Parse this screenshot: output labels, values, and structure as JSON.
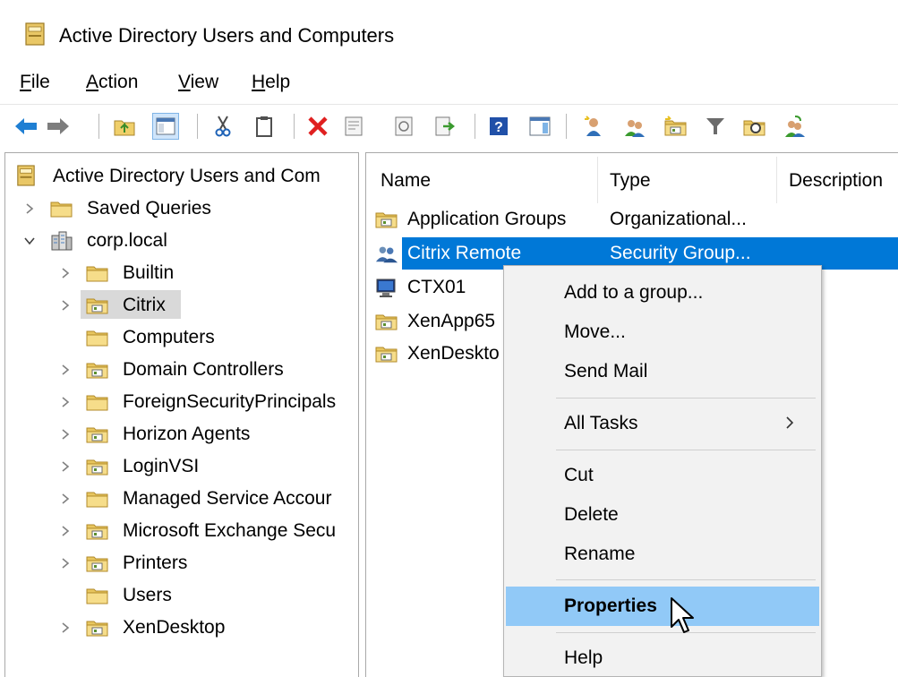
{
  "window": {
    "title": "Active Directory Users and Computers"
  },
  "menubar": [
    {
      "label": "File",
      "underline": "F",
      "rest": "ile"
    },
    {
      "label": "Action",
      "underline": "A",
      "rest": "ction"
    },
    {
      "label": "View",
      "underline": "V",
      "rest": "iew"
    },
    {
      "label": "Help",
      "underline": "H",
      "rest": "elp"
    }
  ],
  "toolbar": {
    "buttons": [
      "back-icon",
      "forward-icon",
      "up-folder-icon",
      "show-tree-icon",
      "cut-icon",
      "copy-icon",
      "delete-icon",
      "properties-icon",
      "refresh-icon",
      "export-list-icon",
      "help-icon",
      "mmc-icon",
      "new-user-icon",
      "new-group-icon",
      "new-ou-icon",
      "filter-icon",
      "find-icon",
      "add-to-group-icon"
    ]
  },
  "tree": {
    "root": "Active Directory Users and Com",
    "items": [
      {
        "label": "Saved Queries"
      },
      {
        "label": "corp.local"
      },
      {
        "label": "Builtin"
      },
      {
        "label": "Citrix"
      },
      {
        "label": "Computers"
      },
      {
        "label": "Domain Controllers"
      },
      {
        "label": "ForeignSecurityPrincipals"
      },
      {
        "label": "Horizon Agents"
      },
      {
        "label": "LoginVSI"
      },
      {
        "label": "Managed Service Accour"
      },
      {
        "label": "Microsoft Exchange Secu"
      },
      {
        "label": "Printers"
      },
      {
        "label": "Users"
      },
      {
        "label": "XenDesktop"
      }
    ]
  },
  "list": {
    "columns": [
      "Name",
      "Type",
      "Description"
    ],
    "rows": [
      {
        "name": "Application Groups",
        "type": "Organizational..."
      },
      {
        "name": "Citrix Remote",
        "type": "Security Group..."
      },
      {
        "name": "CTX01",
        "type": ""
      },
      {
        "name": "XenApp65",
        "type": ""
      },
      {
        "name": "XenDeskto",
        "type": ""
      }
    ]
  },
  "context_menu": {
    "items": [
      "Add to a group...",
      "Move...",
      "Send Mail",
      "All Tasks",
      "Cut",
      "Delete",
      "Rename",
      "Properties",
      "Help"
    ]
  },
  "colors": {
    "selection": "#0078d7",
    "menu_hover": "#91c9f7",
    "menu_bg": "#f2f2f2",
    "tree_selected": "#d9d9d9"
  }
}
